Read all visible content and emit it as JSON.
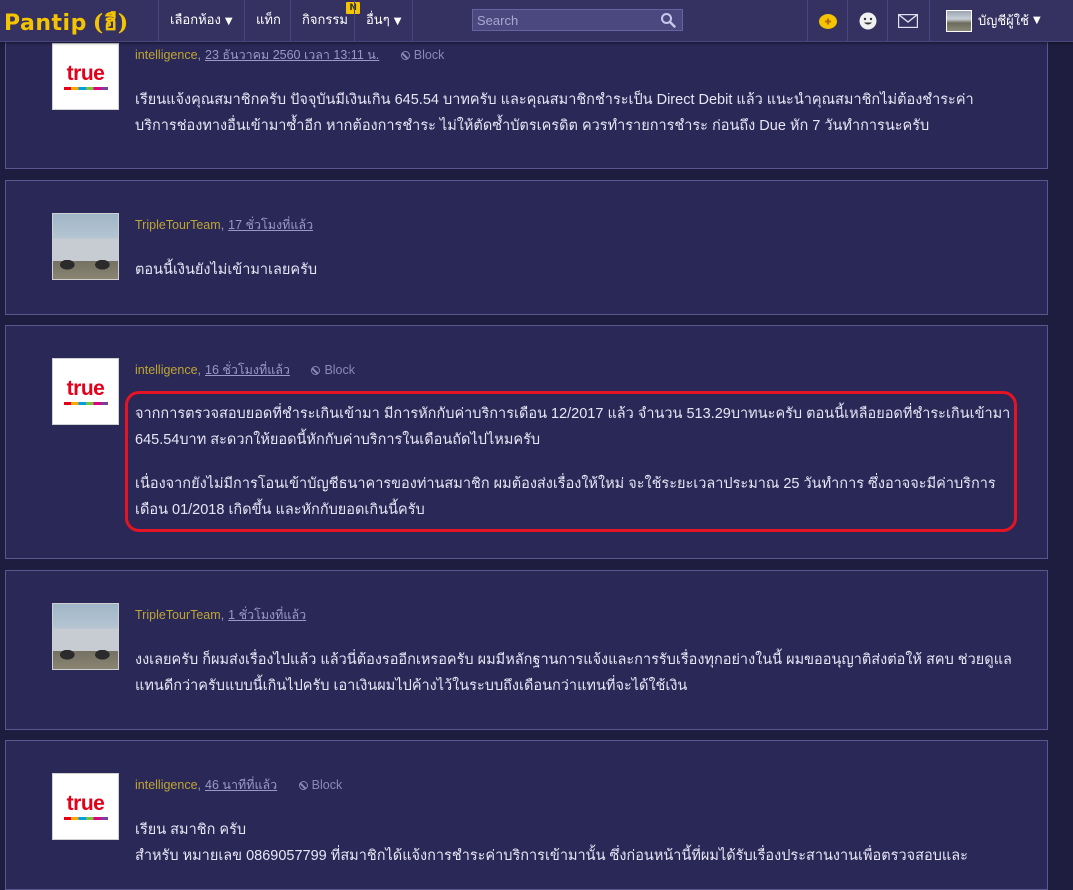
{
  "nav": {
    "logo": "Pantip",
    "logo_mark": "(ฮื)",
    "items": [
      {
        "label": "เลือกห้อง",
        "caret": "▼"
      },
      {
        "label": "แท็ก"
      },
      {
        "label": "กิจกรรม",
        "badge": "N"
      },
      {
        "label": "อื่นๆ",
        "caret": "▼"
      }
    ],
    "search_placeholder": "Search",
    "user": {
      "label": "บัญชีผู้ใช้",
      "caret": "▼"
    },
    "icons": [
      "add-emoji-icon",
      "smiley-icon",
      "mail-icon",
      "search-icon"
    ]
  },
  "comments": [
    {
      "author": "intelligence",
      "time": "23 ธันวาคม 2560 เวลา 13:11 น.",
      "block_label": "Block",
      "avatar": "true-logo",
      "logo_text": "true",
      "paragraphs": [
        "เรียนแจ้งคุณสมาชิกครับ ปัจจุบันมีเงินเกิน 645.54 บาทครับ และคุณสมาชิกชำระเป็น Direct Debit แล้ว แนะนำคุณสมาชิกไม่ต้องชำระค่าบริการช่องทางอื่นเข้ามาซ้ำอีก หากต้องการชำระ ไม่ให้ตัดซ้ำบัตรเครดิต ควรทำรายการชำระ ก่อนถึง Due หัก 7 วันทำการนะครับ"
      ]
    },
    {
      "author": "TripleTourTeam",
      "time": "17 ชั่วโมงที่แล้ว",
      "avatar": "car",
      "paragraphs": [
        "ตอนนี้เงินยังไม่เข้ามาเลยครับ"
      ]
    },
    {
      "author": "intelligence",
      "time": "16 ชั่วโมงที่แล้ว",
      "block_label": "Block",
      "avatar": "true-logo",
      "logo_text": "true",
      "paragraphs": [
        "จากการตรวจสอบยอดที่ชำระเกินเข้ามา มีการหักกับค่าบริการเดือน 12/2017 แล้ว จำนวน 513.29บาทนะครับ ตอนนี้เหลือยอดที่ชำระเกินเข้ามา 645.54บาท สะดวกให้ยอดนี้หักกับค่าบริการในเดือนถัดไปไหมครับ",
        "เนื่องจากยังไม่มีการโอนเข้าบัญชีธนาคารของท่านสมาชิก ผมต้องส่งเรื่องให้ใหม่ จะใช้ระยะเวลาประมาณ 25 วันทำการ ซึ่งอาจจะมีค่าบริการเดือน 01/2018 เกิดขึ้น และหักกับยอดเกินนี้ครับ"
      ]
    },
    {
      "author": "TripleTourTeam",
      "time": "1 ชั่วโมงที่แล้ว",
      "avatar": "car",
      "paragraphs": [
        "งงเลยครับ ก็ผมส่งเรื่องไปแล้ว แล้วนี่ต้องรออีกเหรอครับ ผมมีหลักฐานการแจ้งและการรับเรื่องทุกอย่างในนี้ ผมขออนุญาติส่งต่อให้ สคบ ช่วยดูแลแทนดีกว่าครับแบบนี้เกินไปครับ เอาเงินผมไปค้างไว้ในระบบถึงเดือนกว่าแทนที่จะได้ใช้เงิน"
      ]
    },
    {
      "author": "intelligence",
      "time": "46 นาทีที่แล้ว",
      "block_label": "Block",
      "avatar": "true-logo",
      "logo_text": "true",
      "paragraphs": [
        "เรียน สมาชิก ครับ",
        "สำหรับ หมายเลข 0869057799 ที่สมาชิกได้แจ้งการชำระค่าบริการเข้ามานั้น ซึ่งก่อนหน้านี้ที่ผมได้รับเรื่องประสานงานเพื่อตรวจสอบและ"
      ]
    }
  ]
}
